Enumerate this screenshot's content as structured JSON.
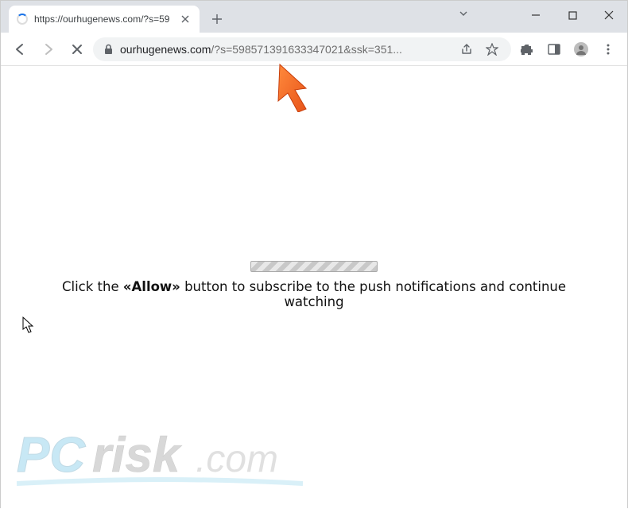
{
  "window": {
    "tab_title": "https://ourhugenews.com/?s=59",
    "url_domain": "ourhugenews.com",
    "url_rest": "/?s=598571391633347021&ssk=351..."
  },
  "page": {
    "message_prefix": "Click the ",
    "message_allow": "«Allow»",
    "message_suffix": " button to subscribe to the push notifications and continue watching"
  },
  "watermark": {
    "text": "PCrisk.com"
  }
}
